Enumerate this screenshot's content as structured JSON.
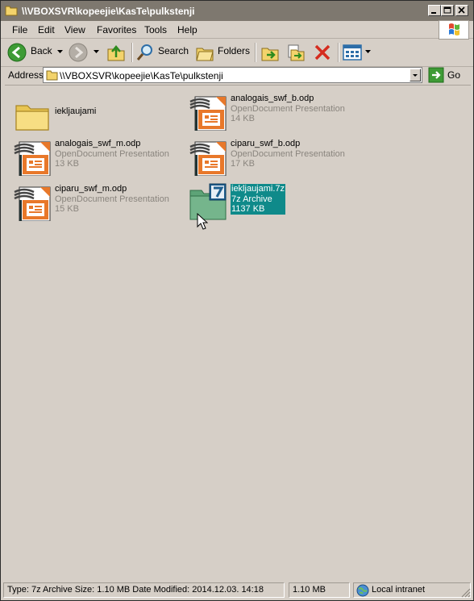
{
  "window": {
    "title": "\\\\VBOXSVR\\kopeejie\\KasTe\\pulkstenji"
  },
  "menu": {
    "items": [
      "File",
      "Edit",
      "View",
      "Favorites",
      "Tools",
      "Help"
    ]
  },
  "toolbar": {
    "back_label": "Back",
    "search_label": "Search",
    "folders_label": "Folders"
  },
  "address": {
    "label": "Address",
    "value": "\\\\VBOXSVR\\kopeejie\\KasTe\\pulkstenji",
    "go_label": "Go"
  },
  "files": [
    {
      "name": "iekljaujami",
      "type": "",
      "size": "",
      "kind": "folder"
    },
    {
      "name": "analogais_swf_b.odp",
      "type": "OpenDocument Presentation",
      "size": "14 KB",
      "kind": "odp"
    },
    {
      "name": "analogais_swf_m.odp",
      "type": "OpenDocument Presentation",
      "size": "13 KB",
      "kind": "odp"
    },
    {
      "name": "ciparu_swf_b.odp",
      "type": "OpenDocument Presentation",
      "size": "17 KB",
      "kind": "odp"
    },
    {
      "name": "ciparu_swf_m.odp",
      "type": "OpenDocument Presentation",
      "size": "15 KB",
      "kind": "odp"
    },
    {
      "name": "iekljaujami.7z",
      "type": "7z Archive",
      "size": "1137 KB",
      "kind": "7z",
      "selected": true
    }
  ],
  "status": {
    "info": "Type: 7z Archive Size: 1.10 MB Date Modified: 2014.12.03. 14:18",
    "size": "1.10 MB",
    "zone": "Local intranet"
  }
}
